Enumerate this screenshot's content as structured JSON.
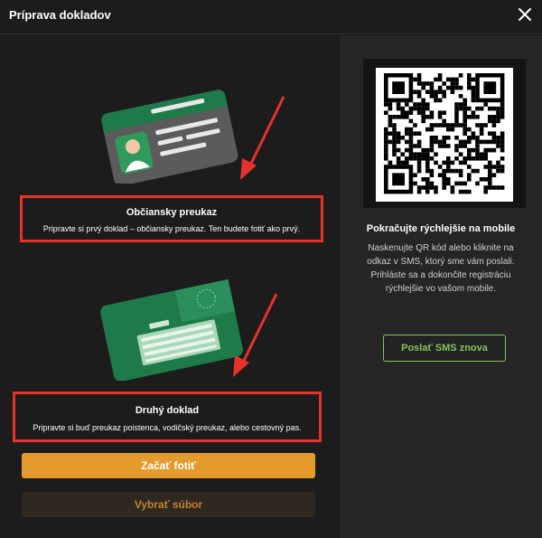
{
  "dialog": {
    "title": "Príprava dokladov"
  },
  "id_card": {
    "title": "Občiansky preukaz",
    "description": "Pripravte si prvý doklad – občiansky preukaz. Ten budete fotiť ako prvý."
  },
  "second_doc": {
    "title": "Druhý doklad",
    "description": "Pripravte si buď preukaz poistenca, vodičský preukaz, alebo cestovný pas."
  },
  "actions": {
    "start_photo": "Začať fotiť",
    "choose_file": "Vybrať súbor"
  },
  "mobile": {
    "title": "Pokračujte rýchlejšie na mobile",
    "description": "Naskenujte QR kód alebo kliknite na odkaz v SMS, ktorý sme vám poslali. Prihláste sa a dokončite registráciu rýchlejšie vo vašom mobile.",
    "resend_sms": "Poslať SMS znova"
  },
  "colors": {
    "accent_orange": "#e49a2d",
    "highlight_red": "#e5322b",
    "sms_green": "#7fc660",
    "card_green": "#1f7a4a"
  }
}
